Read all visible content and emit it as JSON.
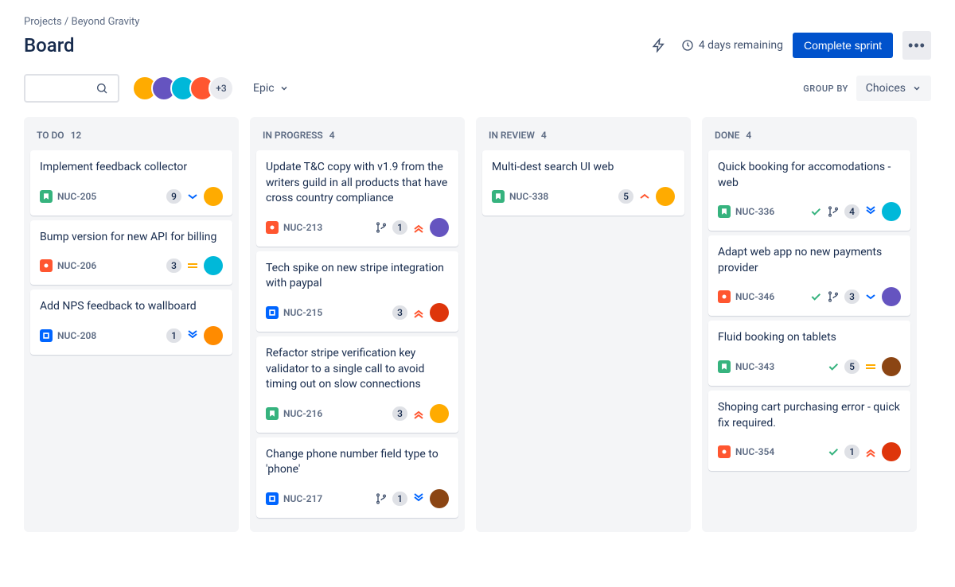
{
  "breadcrumb": {
    "root": "Projects",
    "project": "Beyond Gravity"
  },
  "title": "Board",
  "header": {
    "remaining": "4 days remaining",
    "completeSprint": "Complete sprint"
  },
  "filter": {
    "label": "Epic"
  },
  "groupBy": {
    "label": "GROUP BY",
    "value": "Choices"
  },
  "avatarOverflow": "+3",
  "avatarColors": [
    "#FFAB00",
    "#6554C0",
    "#00B8D9",
    "#FF5630"
  ],
  "columns": [
    {
      "name": "TO DO",
      "count": "12",
      "cards": [
        {
          "title": "Implement feedback collector",
          "id": "NUC-205",
          "type": "story",
          "points": "9",
          "priority": "low",
          "avatar": "#FFAB00"
        },
        {
          "title": "Bump version for new API for billing",
          "id": "NUC-206",
          "type": "bug",
          "points": "3",
          "priority": "medium",
          "avatar": "#00B8D9"
        },
        {
          "title": "Add NPS feedback to wallboard",
          "id": "NUC-208",
          "type": "task",
          "points": "1",
          "priority": "lowest",
          "avatar": "#FF8B00"
        }
      ]
    },
    {
      "name": "IN PROGRESS",
      "count": "4",
      "cards": [
        {
          "title": "Update T&C copy with v1.9 from the writers guild in all products that have cross country compliance",
          "id": "NUC-213",
          "type": "bug",
          "branch": true,
          "points": "1",
          "priority": "highest",
          "avatar": "#6554C0"
        },
        {
          "title": "Tech spike on new stripe integration with paypal",
          "id": "NUC-215",
          "type": "task",
          "points": "3",
          "priority": "highest",
          "avatar": "#DE350B"
        },
        {
          "title": "Refactor stripe verification key validator to a single call to avoid timing out on slow connections",
          "id": "NUC-216",
          "type": "story",
          "points": "3",
          "priority": "highest",
          "avatar": "#FFAB00"
        },
        {
          "title": "Change phone number field type to 'phone'",
          "id": "NUC-217",
          "type": "task",
          "branch": true,
          "points": "1",
          "priority": "lowest",
          "avatar": "#8B4513"
        }
      ]
    },
    {
      "name": "IN REVIEW",
      "count": "4",
      "cards": [
        {
          "title": "Multi-dest search UI web",
          "id": "NUC-338",
          "type": "story",
          "points": "5",
          "priority": "high",
          "avatar": "#FFAB00"
        }
      ]
    },
    {
      "name": "DONE",
      "count": "4",
      "cards": [
        {
          "title": "Quick booking for accomodations - web",
          "id": "NUC-336",
          "type": "story",
          "done": true,
          "branch": true,
          "points": "4",
          "priority": "lowest",
          "avatar": "#00B8D9"
        },
        {
          "title": "Adapt web app no new payments provider",
          "id": "NUC-346",
          "type": "bug",
          "done": true,
          "branch": true,
          "points": "3",
          "priority": "low",
          "avatar": "#6554C0"
        },
        {
          "title": "Fluid booking on tablets",
          "id": "NUC-343",
          "type": "story",
          "done": true,
          "points": "5",
          "priority": "medium",
          "avatar": "#8B4513"
        },
        {
          "title": "Shoping cart purchasing error - quick fix required.",
          "id": "NUC-354",
          "type": "bug",
          "done": true,
          "points": "1",
          "priority": "highest",
          "avatar": "#DE350B"
        }
      ]
    }
  ]
}
